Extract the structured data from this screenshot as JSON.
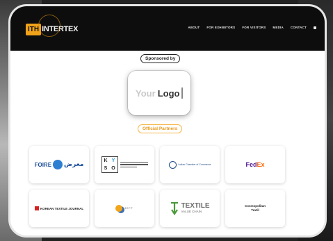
{
  "navbar": {
    "logo_badge": "ITH",
    "logo_text": "INTERTEX",
    "links": [
      "ABOUT",
      "FOR EXHIBITORS",
      "FOR VISITORS",
      "MEDIA",
      "CONTACT"
    ]
  },
  "sponsored": {
    "pill_label": "Sponsored by",
    "placeholder_your": "Your",
    "placeholder_logo": "Logo"
  },
  "partners": {
    "pill_label": "Official Partners",
    "items": [
      {
        "name": "FOIRE",
        "sub": "معرض"
      },
      {
        "name": "KYSO",
        "letters": [
          "K",
          "Y",
          "S",
          "O"
        ]
      },
      {
        "name": "Indian Chamber of Commerce"
      },
      {
        "name_a": "Fed",
        "name_b": "Ex"
      },
      {
        "name": "KOREAN TEXTILE JOURNAL"
      },
      {
        "name": "JEFF"
      },
      {
        "name_a": "TEXTILE",
        "name_b": "VALUE CHAIN"
      },
      {
        "name_a": "Cosmopolitan",
        "name_b": "Textil"
      }
    ]
  },
  "colors": {
    "nav_bg": "#0d0d0d",
    "accent": "#f0a21a",
    "fedex_purple": "#4d148c",
    "fedex_orange": "#ff6600"
  }
}
